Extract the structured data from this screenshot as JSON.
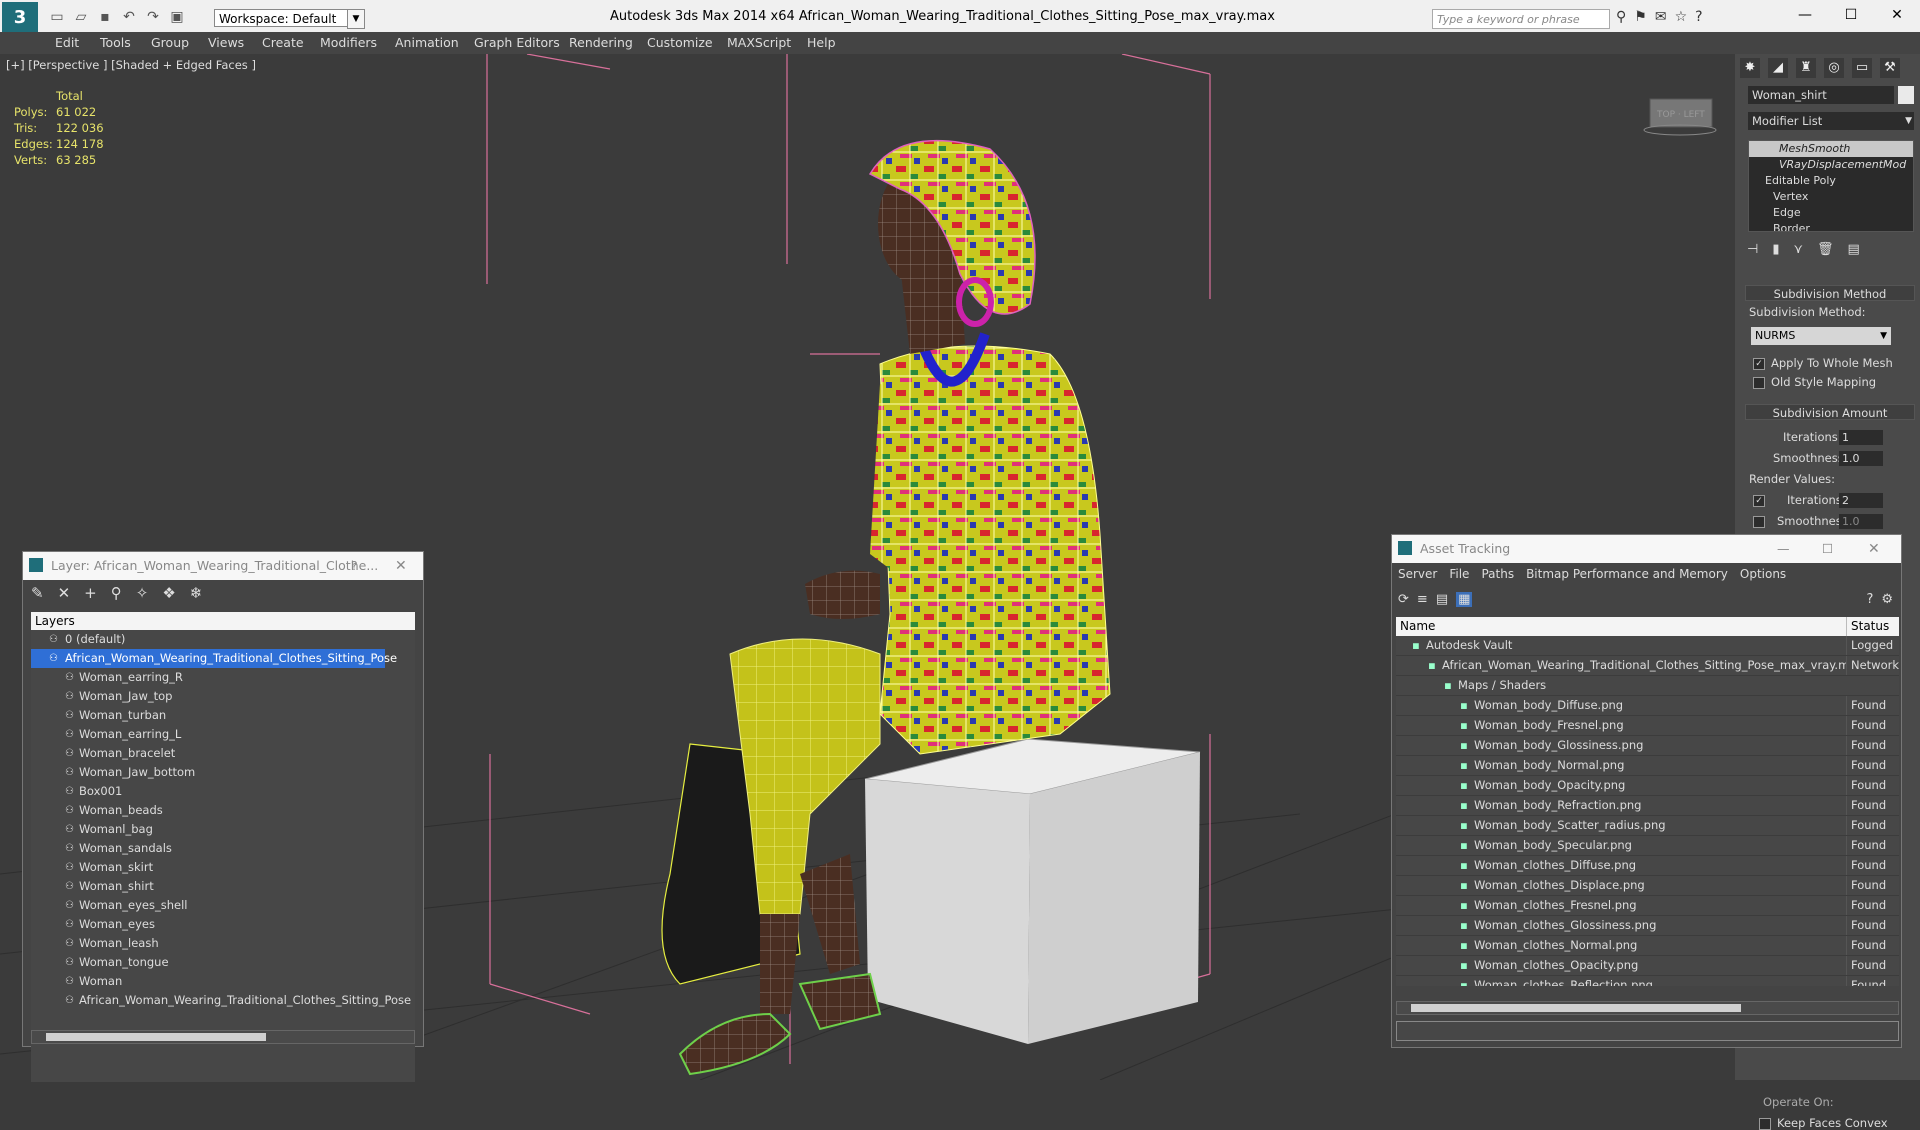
{
  "app": {
    "title": "Autodesk 3ds Max  2014 x64     African_Woman_Wearing_Traditional_Clothes_Sitting_Pose_max_vray.max",
    "workspace": "Workspace: Default",
    "search_placeholder": "Type a keyword or phrase"
  },
  "menu": [
    "Edit",
    "Tools",
    "Group",
    "Views",
    "Create",
    "Modifiers",
    "Animation",
    "Graph Editors",
    "Rendering",
    "Customize",
    "MAXScript",
    "Help"
  ],
  "viewport": {
    "label": "[+] [Perspective ] [Shaded + Edged Faces ]",
    "stats": {
      "header": "Total",
      "rows": [
        {
          "k": "Polys:",
          "v": "61 022"
        },
        {
          "k": "Tris:",
          "v": "122 036"
        },
        {
          "k": "Edges:",
          "v": "124 178"
        },
        {
          "k": "Verts:",
          "v": "63 285"
        }
      ]
    }
  },
  "command_panel": {
    "object_name": "Woman_shirt",
    "modifier_list": "Modifier List",
    "stack": [
      "MeshSmooth",
      "VRayDisplacementMod",
      "Editable Poly",
      "Vertex",
      "Edge",
      "Border"
    ],
    "rollout1": "Subdivision Method",
    "method_label": "Subdivision Method:",
    "method_value": "NURMS",
    "apply_whole": "Apply To Whole Mesh",
    "old_style": "Old Style Mapping",
    "rollout2": "Subdivision Amount",
    "iterations_label": "Iterations:",
    "iterations_value": "1",
    "smoothness_label": "Smoothness:",
    "smoothness_value": "1.0",
    "render_values": "Render Values:",
    "r_iterations_label": "Iterations:",
    "r_iterations_value": "2",
    "r_smoothness_label": "Smoothness:",
    "r_smoothness_value": "1.0",
    "operate_on": "Operate On:",
    "keep_faces": "Keep Faces Convex"
  },
  "layer_dialog": {
    "title": "Layer: African_Woman_Wearing_Traditional_Clothe...",
    "help": "?",
    "header": "Layers",
    "items": [
      {
        "name": "0 (default)",
        "indent": 0,
        "selected": false
      },
      {
        "name": "African_Woman_Wearing_Traditional_Clothes_Sitting_Pose",
        "indent": 0,
        "selected": true
      },
      {
        "name": "Woman_earring_R",
        "indent": 1,
        "selected": false
      },
      {
        "name": "Woman_Jaw_top",
        "indent": 1,
        "selected": false
      },
      {
        "name": "Woman_turban",
        "indent": 1,
        "selected": false
      },
      {
        "name": "Woman_earring_L",
        "indent": 1,
        "selected": false
      },
      {
        "name": "Woman_bracelet",
        "indent": 1,
        "selected": false
      },
      {
        "name": "Woman_Jaw_bottom",
        "indent": 1,
        "selected": false
      },
      {
        "name": "Box001",
        "indent": 1,
        "selected": false
      },
      {
        "name": "Woman_beads",
        "indent": 1,
        "selected": false
      },
      {
        "name": "Womanl_bag",
        "indent": 1,
        "selected": false
      },
      {
        "name": "Woman_sandals",
        "indent": 1,
        "selected": false
      },
      {
        "name": "Woman_skirt",
        "indent": 1,
        "selected": false
      },
      {
        "name": "Woman_shirt",
        "indent": 1,
        "selected": false
      },
      {
        "name": "Woman_eyes_shell",
        "indent": 1,
        "selected": false
      },
      {
        "name": "Woman_eyes",
        "indent": 1,
        "selected": false
      },
      {
        "name": "Woman_leash",
        "indent": 1,
        "selected": false
      },
      {
        "name": "Woman_tongue",
        "indent": 1,
        "selected": false
      },
      {
        "name": "Woman",
        "indent": 1,
        "selected": false
      },
      {
        "name": "African_Woman_Wearing_Traditional_Clothes_Sitting_Pose",
        "indent": 1,
        "selected": false
      }
    ]
  },
  "asset_tracking": {
    "title": "Asset Tracking",
    "menu": [
      "Server",
      "File",
      "Paths",
      "Bitmap Performance and Memory",
      "Options"
    ],
    "col_name": "Name",
    "col_status": "Status",
    "rows": [
      {
        "name": "Autodesk Vault",
        "indent": 1,
        "status": "Logged"
      },
      {
        "name": "African_Woman_Wearing_Traditional_Clothes_Sitting_Pose_max_vray.max",
        "indent": 2,
        "status": "Network"
      },
      {
        "name": "Maps / Shaders",
        "indent": 3,
        "status": ""
      },
      {
        "name": "Woman_body_Diffuse.png",
        "indent": 4,
        "status": "Found"
      },
      {
        "name": "Woman_body_Fresnel.png",
        "indent": 4,
        "status": "Found"
      },
      {
        "name": "Woman_body_Glossiness.png",
        "indent": 4,
        "status": "Found"
      },
      {
        "name": "Woman_body_Normal.png",
        "indent": 4,
        "status": "Found"
      },
      {
        "name": "Woman_body_Opacity.png",
        "indent": 4,
        "status": "Found"
      },
      {
        "name": "Woman_body_Refraction.png",
        "indent": 4,
        "status": "Found"
      },
      {
        "name": "Woman_body_Scatter_radius.png",
        "indent": 4,
        "status": "Found"
      },
      {
        "name": "Woman_body_Specular.png",
        "indent": 4,
        "status": "Found"
      },
      {
        "name": "Woman_clothes_Diffuse.png",
        "indent": 4,
        "status": "Found"
      },
      {
        "name": "Woman_clothes_Displace.png",
        "indent": 4,
        "status": "Found"
      },
      {
        "name": "Woman_clothes_Fresnel.png",
        "indent": 4,
        "status": "Found"
      },
      {
        "name": "Woman_clothes_Glossiness.png",
        "indent": 4,
        "status": "Found"
      },
      {
        "name": "Woman_clothes_Normal.png",
        "indent": 4,
        "status": "Found"
      },
      {
        "name": "Woman_clothes_Opacity.png",
        "indent": 4,
        "status": "Found"
      },
      {
        "name": "Woman_clothes_Reflection.png",
        "indent": 4,
        "status": "Found"
      }
    ]
  }
}
